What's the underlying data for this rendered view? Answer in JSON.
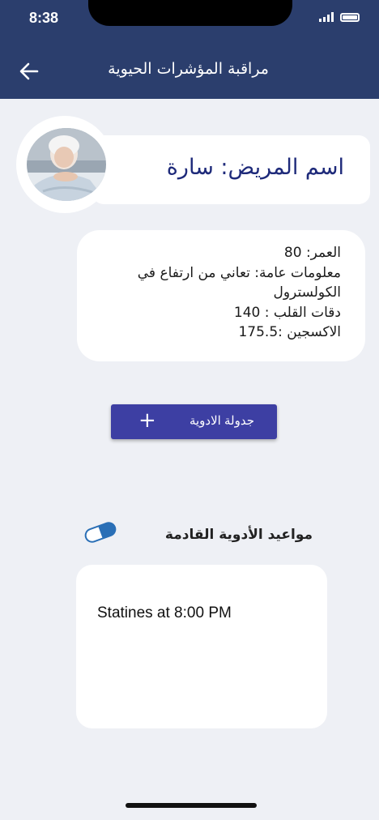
{
  "status_bar": {
    "time": "8:38"
  },
  "header": {
    "title": "مراقبة المؤشرات الحيوية",
    "back_icon": "arrow-left-icon"
  },
  "patient": {
    "name_line": "اسم المريض: سارة",
    "info_lines": [
      "العمر:  80",
      "معلومات عامة: تعاني من ارتفاع في الكولسترول",
      "دقات القلب : 140",
      "الاكسجين :175.5"
    ]
  },
  "actions": {
    "schedule_label": "جدولة الادوية",
    "schedule_icon": "plus-icon"
  },
  "upcoming": {
    "title": "مواعيد الأدوية القادمة",
    "icon": "pill-icon",
    "items": [
      "Statines at 8:00 PM"
    ]
  },
  "colors": {
    "header_bg": "#2b3e6d",
    "button_bg": "#3d3fa3",
    "name_text": "#1e2a7a",
    "pill_blue": "#2a6fb6",
    "page_bg": "#eef0f5"
  }
}
